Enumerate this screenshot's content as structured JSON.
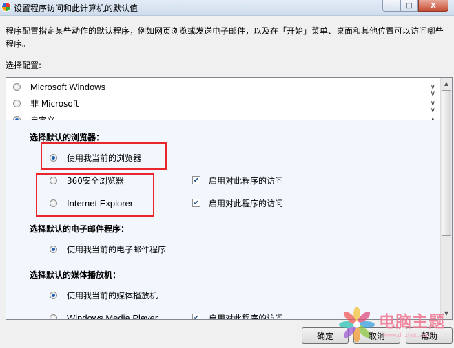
{
  "window": {
    "title": "设置程序访问和此计算机的默认值",
    "controls": {
      "minimize": "–",
      "maximize": "□",
      "close": "X"
    }
  },
  "description": "程序配置指定某些动作的默认程序，例如网页浏览或发送电子邮件，以及在「开始」菜单、桌面和其他位置可以访问哪些程序。",
  "select_config_label": "选择配置:",
  "configs": [
    {
      "label": "Microsoft Windows",
      "selected": false
    },
    {
      "label": "非 Microsoft",
      "selected": false
    },
    {
      "label": "自定义",
      "selected": true
    }
  ],
  "custom": {
    "browser": {
      "heading": "选择默认的浏览器：",
      "use_current": "使用我当前的浏览器",
      "programs": [
        {
          "name": "360安全浏览器",
          "enable_label": "启用对此程序的访问",
          "enabled": true
        },
        {
          "name": "Internet Explorer",
          "enable_label": "启用对此程序的访问",
          "enabled": true
        }
      ]
    },
    "email": {
      "heading": "选择默认的电子邮件程序：",
      "use_current": "使用我当前的电子邮件程序"
    },
    "media": {
      "heading": "选择默认的媒体播放机：",
      "use_current": "使用我当前的媒体播放机",
      "programs": [
        {
          "name": "Windows Media Player",
          "enable_label": "启用对此程序的访问",
          "enabled": true
        }
      ]
    }
  },
  "buttons": {
    "ok": "确定",
    "cancel": "取消",
    "help": "帮助"
  },
  "watermark": {
    "brand": "电脑主题",
    "url": "www.dnzhuti.com"
  },
  "colors": {
    "annotation_box": "#e8262c",
    "custom_area_bg": "#f2f7fd",
    "radio_dot": "#1e5fb3"
  }
}
